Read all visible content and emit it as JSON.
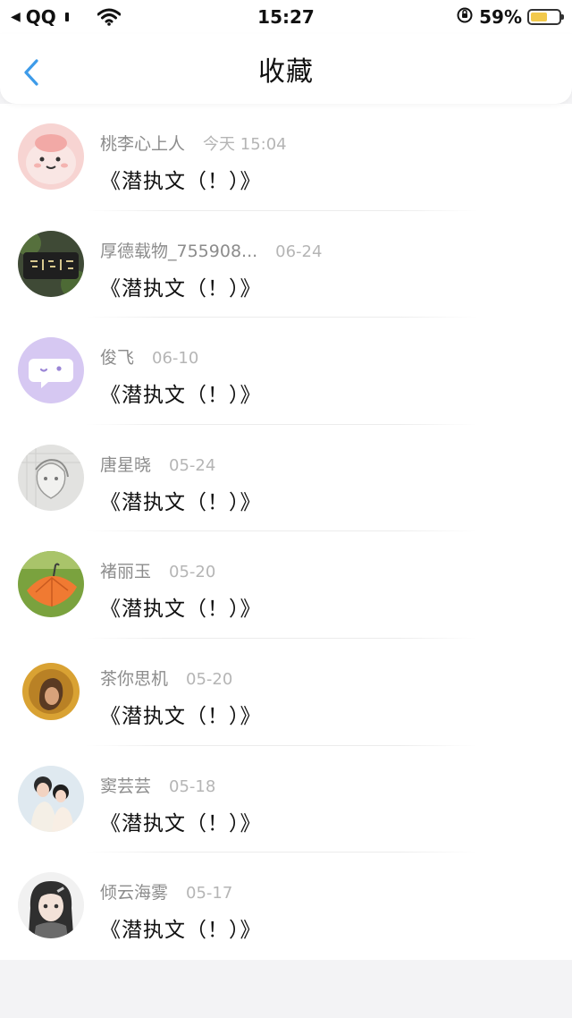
{
  "status_bar": {
    "carrier": "QQ",
    "time": "15:27",
    "battery": "59%",
    "battery_level": 0.59,
    "battery_color": "#f2c94c"
  },
  "nav": {
    "title": "收藏",
    "back_icon": "chevron-left-icon",
    "accent": "#3d9be9"
  },
  "favorites": [
    {
      "author": "桃李心上人",
      "date": "今天 15:04",
      "title": "《潜执文（！）》",
      "avatar": "pink-cartoon"
    },
    {
      "author": "厚德载物_755908...",
      "date": "06-24",
      "title": "《潜执文（！）》",
      "avatar": "stone-inscription"
    },
    {
      "author": "俊飞",
      "date": "06-10",
      "title": "《潜执文（！）》",
      "avatar": "purple-chat-bubble"
    },
    {
      "author": "唐星晓",
      "date": "05-24",
      "title": "《潜执文（！）》",
      "avatar": "pencil-sketch"
    },
    {
      "author": "褚丽玉",
      "date": "05-20",
      "title": "《潜执文（！）》",
      "avatar": "orange-umbrella"
    },
    {
      "author": "茶你思机",
      "date": "05-20",
      "title": "《潜执文（！）》",
      "avatar": "sunflower-portrait"
    },
    {
      "author": "窦芸芸",
      "date": "05-18",
      "title": "《潜执文（！）》",
      "avatar": "couple-illustration"
    },
    {
      "author": "倾云海雾",
      "date": "05-17",
      "title": "《潜执文（！）》",
      "avatar": "anime-girl"
    }
  ]
}
